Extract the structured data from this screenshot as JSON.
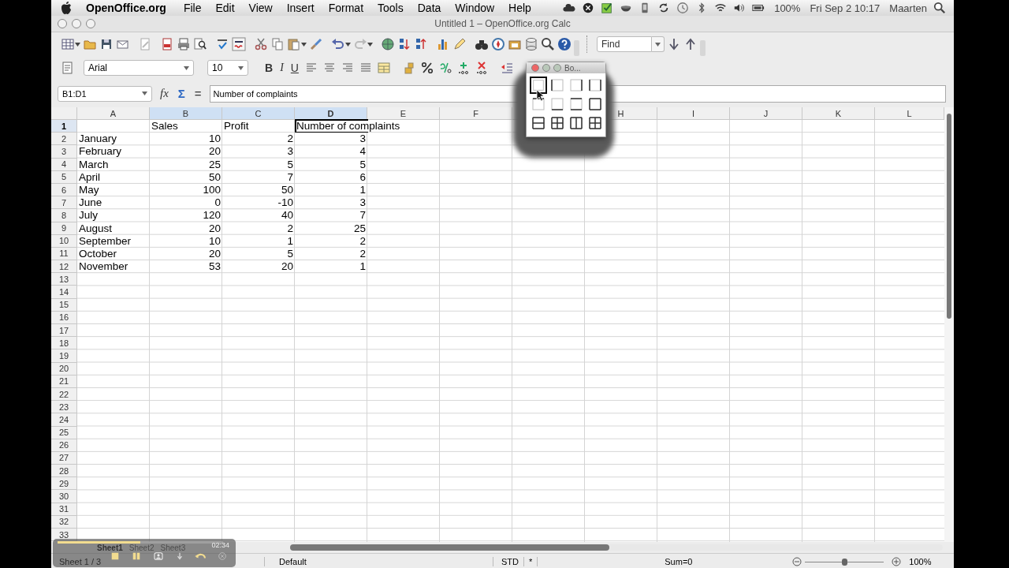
{
  "menu_bar": {
    "app_name": "OpenOffice.org",
    "items": [
      "File",
      "Edit",
      "View",
      "Insert",
      "Format",
      "Tools",
      "Data",
      "Window",
      "Help"
    ],
    "battery": "100%",
    "clock": "Fri Sep 2  10:17",
    "user": "Maarten"
  },
  "window": {
    "title": "Untitled 1 – OpenOffice.org Calc"
  },
  "find_bar": {
    "placeholder": "Find"
  },
  "format_bar": {
    "font": "Arial",
    "size": "10",
    "styles": [
      "B",
      "I",
      "U"
    ]
  },
  "formula_bar": {
    "name_box": "B1:D1",
    "buttons": [
      "fx",
      "Σ",
      "="
    ],
    "content": "Number of complaints"
  },
  "borders_popup": {
    "title": "Bo...",
    "options": [
      {
        "kind": "none",
        "selected": true
      },
      {
        "kind": "left",
        "selected": false
      },
      {
        "kind": "right",
        "selected": false
      },
      {
        "kind": "left-right",
        "selected": false
      },
      {
        "kind": "top",
        "selected": false
      },
      {
        "kind": "bottom",
        "selected": false
      },
      {
        "kind": "top-bottom",
        "selected": false
      },
      {
        "kind": "outer",
        "selected": false
      },
      {
        "kind": "outer-hline",
        "selected": false
      },
      {
        "kind": "outer-grid",
        "selected": false
      },
      {
        "kind": "outer-vline",
        "selected": false
      },
      {
        "kind": "all",
        "selected": false
      }
    ]
  },
  "sheet": {
    "columns": [
      {
        "label": "A",
        "kind": "text",
        "selected": false,
        "cursor": false
      },
      {
        "label": "B",
        "kind": "number",
        "selected": true,
        "cursor": false
      },
      {
        "label": "C",
        "kind": "number",
        "selected": true,
        "cursor": false
      },
      {
        "label": "D",
        "kind": "number",
        "selected": true,
        "cursor": true
      },
      {
        "label": "E",
        "kind": "text",
        "selected": false,
        "cursor": false
      },
      {
        "label": "F",
        "kind": "text",
        "selected": false,
        "cursor": false
      },
      {
        "kind": "text"
      },
      {
        "label": "H",
        "kind": "text",
        "selected": false,
        "cursor": false
      },
      {
        "label": "I",
        "kind": "text",
        "selected": false,
        "cursor": false
      },
      {
        "label": "J",
        "kind": "text",
        "selected": false,
        "cursor": false
      },
      {
        "label": "K",
        "kind": "text",
        "selected": false,
        "cursor": false
      },
      {
        "label": "L",
        "kind": "text",
        "selected": false,
        "cursor": false
      }
    ],
    "rows": [
      {
        "label": "1",
        "kind": "labels",
        "selected": true,
        "cursor": true,
        "cells": [
          null,
          "Sales",
          "Profit",
          "Number of complaints"
        ]
      },
      {
        "label": "2",
        "kind": "data",
        "selected": false,
        "cursor": false,
        "cells": [
          "January",
          "10",
          "2",
          "3"
        ]
      },
      {
        "label": "3",
        "kind": "data",
        "selected": false,
        "cursor": false,
        "cells": [
          "February",
          "20",
          "3",
          "4"
        ]
      },
      {
        "label": "4",
        "kind": "data",
        "selected": false,
        "cursor": false,
        "cells": [
          "March",
          "25",
          "5",
          "5"
        ]
      },
      {
        "label": "5",
        "kind": "data",
        "selected": false,
        "cursor": false,
        "cells": [
          "April",
          "50",
          "7",
          "6"
        ]
      },
      {
        "label": "6",
        "kind": "data",
        "selected": false,
        "cursor": false,
        "cells": [
          "May",
          "100",
          "50",
          "1"
        ]
      },
      {
        "label": "7",
        "kind": "data",
        "selected": false,
        "cursor": false,
        "cells": [
          "June",
          "0",
          "-10",
          "3"
        ]
      },
      {
        "label": "8",
        "kind": "data",
        "selected": false,
        "cursor": false,
        "cells": [
          "July",
          "120",
          "40",
          "7"
        ]
      },
      {
        "label": "9",
        "kind": "data",
        "selected": false,
        "cursor": false,
        "cells": [
          "August",
          "20",
          "2",
          "25"
        ]
      },
      {
        "label": "10",
        "kind": "data",
        "selected": false,
        "cursor": false,
        "cells": [
          "September",
          "10",
          "1",
          "2"
        ]
      },
      {
        "label": "11",
        "kind": "data",
        "selected": false,
        "cursor": false,
        "cells": [
          "October",
          "20",
          "5",
          "2"
        ]
      },
      {
        "label": "12",
        "kind": "data",
        "selected": false,
        "cursor": false,
        "cells": [
          "November",
          "53",
          "20",
          "1"
        ]
      },
      {
        "label": "13",
        "kind": "data",
        "selected": false,
        "cursor": false
      },
      {
        "label": "14",
        "kind": "data",
        "selected": false,
        "cursor": false
      },
      {
        "label": "15",
        "kind": "data",
        "selected": false,
        "cursor": false
      },
      {
        "label": "16",
        "kind": "data",
        "selected": false,
        "cursor": false
      },
      {
        "label": "17",
        "kind": "data",
        "selected": false,
        "cursor": false
      },
      {
        "label": "18",
        "kind": "data",
        "selected": false,
        "cursor": false
      },
      {
        "label": "19",
        "kind": "data",
        "selected": false,
        "cursor": false
      },
      {
        "label": "20",
        "kind": "data",
        "selected": false,
        "cursor": false
      },
      {
        "label": "21",
        "kind": "data",
        "selected": false,
        "cursor": false
      },
      {
        "label": "22",
        "kind": "data",
        "selected": false,
        "cursor": false
      },
      {
        "label": "23",
        "kind": "data",
        "selected": false,
        "cursor": false
      },
      {
        "label": "24",
        "kind": "data",
        "selected": false,
        "cursor": false
      },
      {
        "label": "25",
        "kind": "data",
        "selected": false,
        "cursor": false
      },
      {
        "label": "26",
        "kind": "data",
        "selected": false,
        "cursor": false
      },
      {
        "label": "27",
        "kind": "data",
        "selected": false,
        "cursor": false
      },
      {
        "label": "28",
        "kind": "data",
        "selected": false,
        "cursor": false
      },
      {
        "label": "29",
        "kind": "data",
        "selected": false,
        "cursor": false
      },
      {
        "label": "30",
        "kind": "data",
        "selected": false,
        "cursor": false
      },
      {
        "label": "31",
        "kind": "data",
        "selected": false,
        "cursor": false
      },
      {
        "label": "32",
        "kind": "data",
        "selected": false,
        "cursor": false
      },
      {
        "label": "33",
        "kind": "data",
        "selected": false,
        "cursor": false
      }
    ]
  },
  "sheet_tabs": [
    {
      "label": "Sheet1",
      "selected": true
    },
    {
      "label": "Sheet2",
      "selected": false
    },
    {
      "label": "Sheet3",
      "selected": false
    }
  ],
  "recorder": {
    "time": "02:34",
    "level": 0.5
  },
  "status_bar": {
    "page": "Sheet 1 / 3",
    "style": "Default",
    "mode": "STD",
    "modified": "*",
    "sum": "Sum=0",
    "zoom": {
      "level": 0.5,
      "reading": "100%"
    }
  }
}
